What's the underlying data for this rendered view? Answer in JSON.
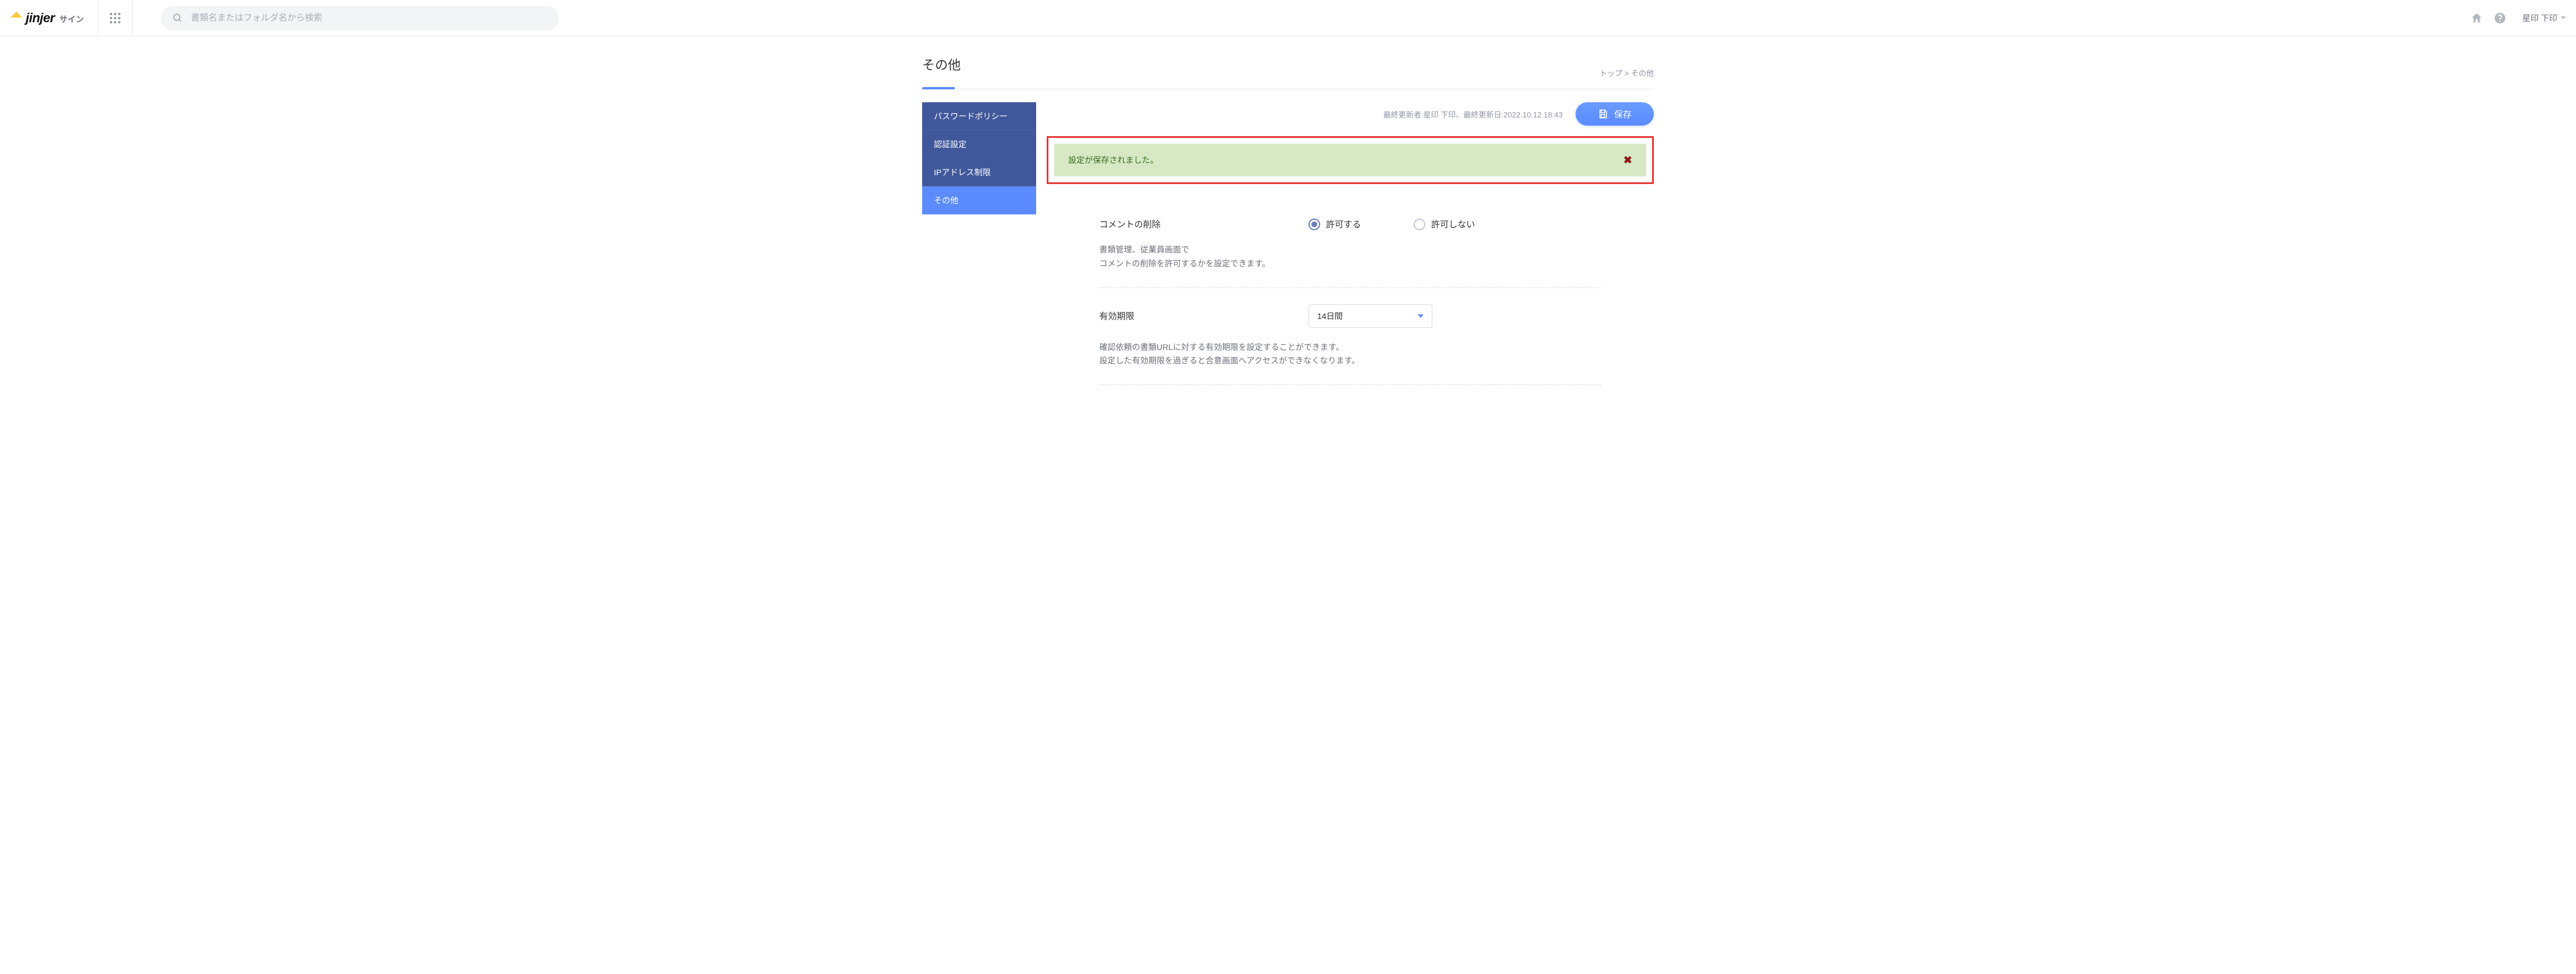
{
  "header": {
    "logo_text": "jinjer",
    "logo_sub": "サイン",
    "search_placeholder": "書類名またはフォルダ名から検索",
    "user_name": "星印 下印"
  },
  "page": {
    "title": "その他",
    "breadcrumb_top": "トップ",
    "breadcrumb_sep": ">",
    "breadcrumb_current": "その他"
  },
  "sidebar": {
    "items": [
      {
        "label": "パスワードポリシー"
      },
      {
        "label": "認証設定"
      },
      {
        "label": "IPアドレス制限"
      },
      {
        "label": "その他"
      }
    ]
  },
  "actions": {
    "last_updated": "最終更新者:星印 下印、最終更新日:2022.10.12 18:43",
    "save_label": "保存"
  },
  "alert": {
    "message": "設定が保存されました。",
    "close_glyph": "✖"
  },
  "settings": {
    "comment_delete": {
      "label": "コメントの削除",
      "option_allow": "許可する",
      "option_deny": "許可しない",
      "desc1": "書類管理、従業員画面で",
      "desc2": "コメントの削除を許可するかを設定できます。"
    },
    "expiry": {
      "label": "有効期限",
      "selected": "14日間",
      "desc1": "確認依頼の書類URLに対する有効期限を設定することができます。",
      "desc2": "設定した有効期限を過ぎると合意画面へアクセスができなくなります。"
    }
  }
}
